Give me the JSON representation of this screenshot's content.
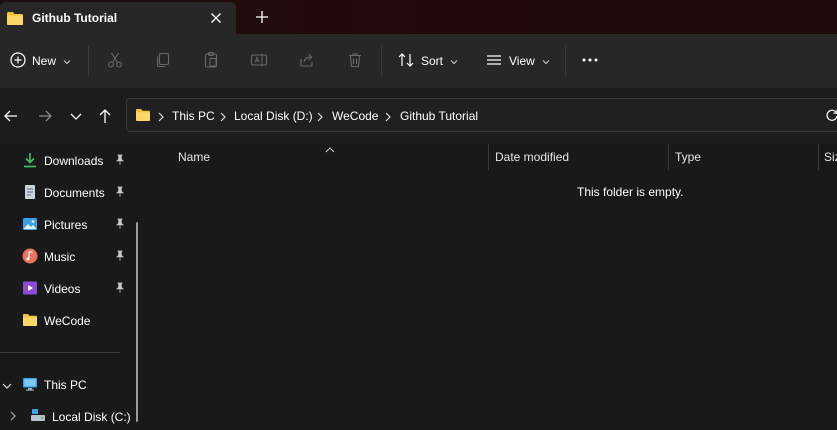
{
  "tab": {
    "title": "Github Tutorial"
  },
  "toolbar": {
    "new_label": "New",
    "sort_label": "Sort",
    "view_label": "View"
  },
  "breadcrumb": [
    "This PC",
    "Local Disk (D:)",
    "WeCode",
    "Github Tutorial"
  ],
  "sidebar": {
    "quick_access": [
      {
        "label": "Downloads",
        "pinned": true,
        "icon": "download-icon"
      },
      {
        "label": "Documents",
        "pinned": true,
        "icon": "document-icon"
      },
      {
        "label": "Pictures",
        "pinned": true,
        "icon": "picture-icon"
      },
      {
        "label": "Music",
        "pinned": true,
        "icon": "music-icon"
      },
      {
        "label": "Videos",
        "pinned": true,
        "icon": "video-icon"
      },
      {
        "label": "WeCode",
        "pinned": false,
        "icon": "folder-icon"
      }
    ],
    "this_pc": "This PC",
    "local_disk_c": "Local Disk (C:)"
  },
  "columns": {
    "name": "Name",
    "date_modified": "Date modified",
    "type": "Type",
    "size": "Size"
  },
  "empty_message": "This folder is empty.",
  "colors": {
    "accent_folder": "#f4c13b",
    "download_green": "#3dbb61",
    "music": "#e85d5d",
    "video": "#8a4bd6",
    "pc_blue": "#3aa0e8"
  }
}
